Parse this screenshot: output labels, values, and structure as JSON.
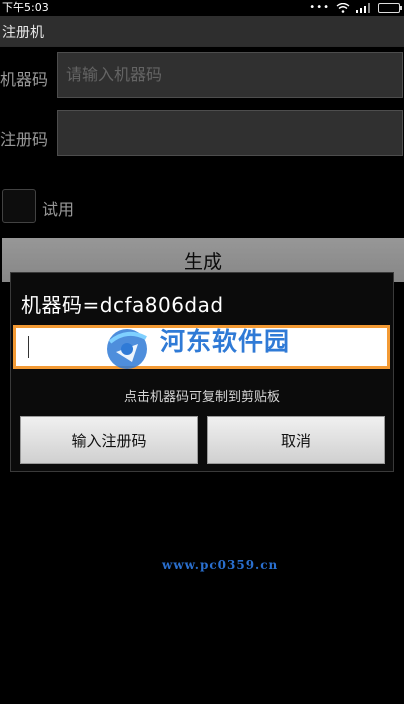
{
  "status_bar": {
    "time": "下午5:03",
    "dots": "•••"
  },
  "app": {
    "title": "注册机"
  },
  "form": {
    "machine_code_label": "机器码",
    "machine_code_placeholder": "请输入机器码",
    "register_code_label": "注册码",
    "trial_label": "试用",
    "generate_button": "生成"
  },
  "dialog": {
    "title": "机器码=dcfa806dad",
    "input_value": "",
    "hint": "点击机器码可复制到剪贴板",
    "confirm_button": "输入注册码",
    "cancel_button": "取消"
  },
  "watermark": {
    "name": "河东软件园",
    "url": "www.pc0359.cn"
  },
  "colors": {
    "accent": "#f39a34",
    "watermark": "#2f7ad6"
  }
}
